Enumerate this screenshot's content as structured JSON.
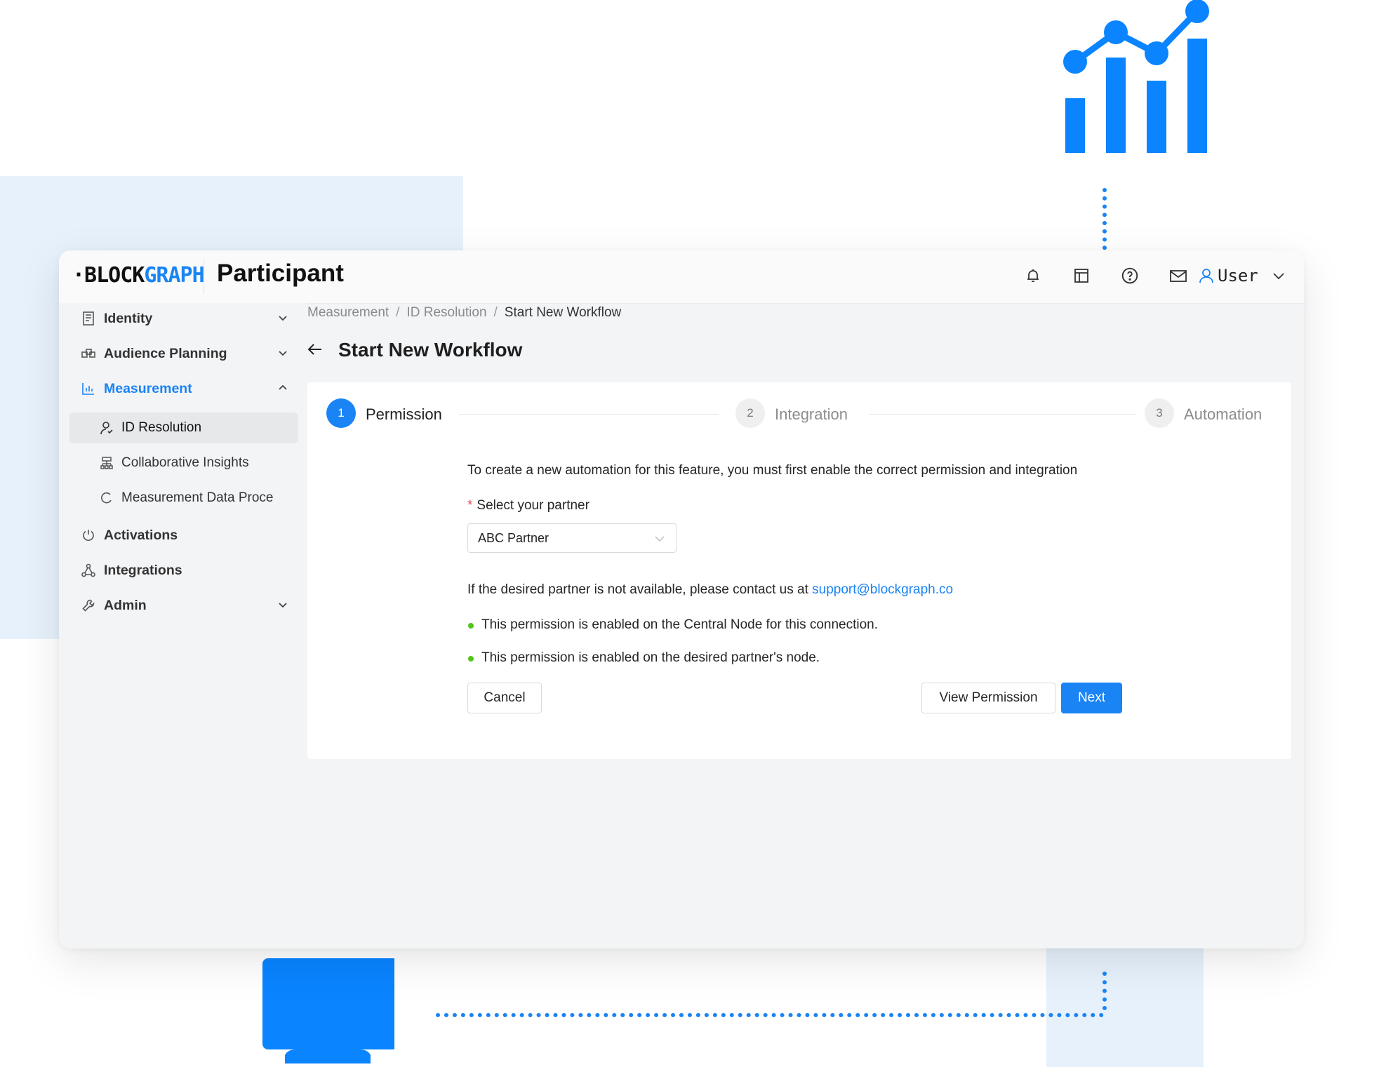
{
  "app": {
    "logo": {
      "part1": "·BLOCK",
      "part2": "GRAPH"
    },
    "title": "Participant"
  },
  "header": {
    "icons": [
      "bell-icon",
      "layout-icon",
      "help-icon",
      "mail-icon"
    ],
    "user_label": "User"
  },
  "sidebar": {
    "items": [
      {
        "label": "Identity",
        "icon": "identity-icon",
        "expanded": false
      },
      {
        "label": "Audience Planning",
        "icon": "audience-icon",
        "expanded": false
      },
      {
        "label": "Measurement",
        "icon": "measurement-icon",
        "expanded": true,
        "active": true
      },
      {
        "label": "Activations",
        "icon": "power-icon"
      },
      {
        "label": "Integrations",
        "icon": "integrations-icon"
      },
      {
        "label": "Admin",
        "icon": "wrench-icon",
        "expanded": false
      }
    ],
    "subitems": [
      {
        "label": "ID Resolution",
        "icon": "user-icon",
        "selected": true
      },
      {
        "label": "Collaborative Insights",
        "icon": "insights-icon"
      },
      {
        "label": "Measurement Data Proce",
        "icon": "loading-icon"
      }
    ]
  },
  "breadcrumb": [
    "Measurement",
    "ID Resolution",
    "Start New Workflow"
  ],
  "page": {
    "title": "Start New Workflow"
  },
  "steps": [
    {
      "number": "1",
      "label": "Permission",
      "active": true
    },
    {
      "number": "2",
      "label": "Integration",
      "active": false
    },
    {
      "number": "3",
      "label": "Automation",
      "active": false
    }
  ],
  "form": {
    "intro": "To create a new automation for this feature, you must first enable the correct permission and integration",
    "required_mark": "*",
    "partner_label": "Select your partner",
    "partner_value": "ABC Partner",
    "contact_text": "If the desired partner is not available, please contact us at ",
    "contact_email": "support@blockgraph.co",
    "checks": [
      "This permission is enabled on the Central Node for this connection.",
      "This permission is enabled on the desired partner's node."
    ],
    "buttons": {
      "cancel": "Cancel",
      "view_permission": "View Permission",
      "next": "Next"
    }
  },
  "colors": {
    "accent": "#1a84f5",
    "success": "#52c41a",
    "background_tint": "#e6f1fc"
  }
}
